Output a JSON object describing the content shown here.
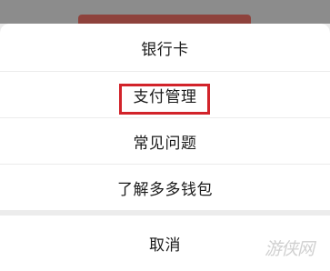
{
  "menu": {
    "items": [
      {
        "label": "银行卡"
      },
      {
        "label": "支付管理"
      },
      {
        "label": "常见问题"
      },
      {
        "label": "了解多多钱包"
      }
    ],
    "cancel_label": "取消"
  },
  "highlight": {
    "target": "支付管理",
    "color": "#d2232a"
  },
  "watermark": {
    "text": "游侠网"
  }
}
